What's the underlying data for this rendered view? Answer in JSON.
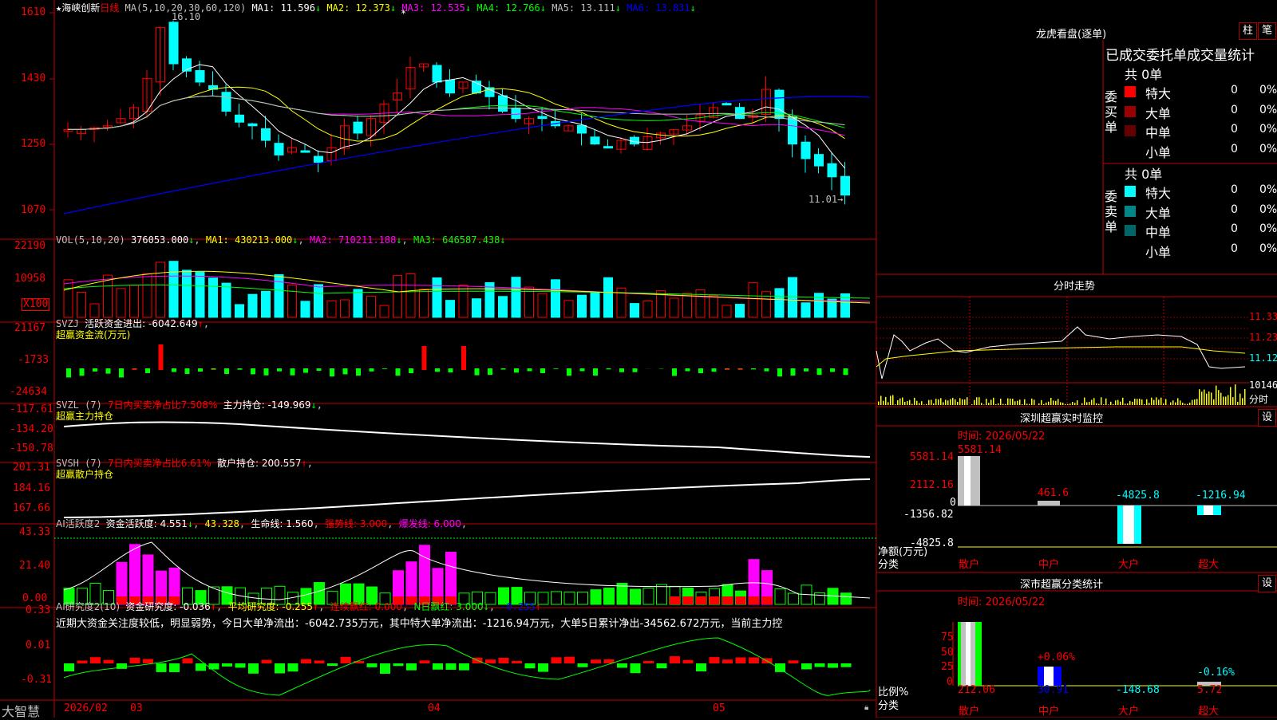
{
  "stock": {
    "name": "海峡创新",
    "period": "日线",
    "star": "★"
  },
  "main": {
    "ma_title": "MA(5,10,20,30,60,120)",
    "ma": [
      {
        "label": "MA1: 11.596",
        "arrow": "↓",
        "color": "#ffffff"
      },
      {
        "label": "MA2: 12.373",
        "arrow": "↓",
        "color": "#ffff00"
      },
      {
        "label": "MA3: 12.535",
        "arrow": "↓",
        "color": "#ff00ff"
      },
      {
        "label": "MA4: 12.766",
        "arrow": "↓",
        "color": "#00ff00"
      },
      {
        "label": "MA5: 13.111",
        "arrow": "↓",
        "color": "#c0c0c0"
      },
      {
        "label": "MA6: 13.831",
        "arrow": "↓",
        "color": "#0000ff"
      }
    ],
    "axis": [
      "1610",
      "1430",
      "1250",
      "1070"
    ],
    "high_label": "16.10",
    "low_label": "11.01"
  },
  "vol": {
    "title": "VOL(5,10,20)",
    "value": "376053.000",
    "ma1": "MA1: 430213.000",
    "ma2": "MA2: 710211.188",
    "ma3": "MA3: 646587.438",
    "axis": [
      "22190",
      "10958"
    ],
    "unit": "X100"
  },
  "svzj": {
    "title": "SVZJ",
    "desc": "活跃资金进出: -6042.649",
    "sub": "超赢资金流(万元)",
    "axis": [
      "21167",
      "-1733",
      "-24634"
    ]
  },
  "svzl": {
    "title": "SVZL (7)",
    "a": "7日内买卖净占比7.508%",
    "b": "主力持仓: -149.969",
    "sub": "超赢主力持仓",
    "axis": [
      "-117.61",
      "-134.20",
      "-150.78"
    ]
  },
  "svsh": {
    "title": "SVSH (7)",
    "a": "7日内买卖净占比6.61%",
    "b": "散户持仓: 200.557",
    "sub": "超赢散户持仓",
    "axis": [
      "201.31",
      "184.16",
      "167.66"
    ]
  },
  "ai1": {
    "title": "AI活跃度2",
    "a": "资金活跃度: 4.551",
    "b": "43.328",
    "c": "生命线: 1.560",
    "d": "强势线: 3.000",
    "e": "爆发线: 6.000",
    "axis": [
      "43.33",
      "21.40",
      "0.00"
    ]
  },
  "ai2": {
    "title": "AI研究度2(10)",
    "a": "资金研究度: -0.036",
    "b": "平均研究度: -0.255",
    "c": "连续飘红: 0.000",
    "d": "N日飘红: 3.000",
    "e": "-0.255",
    "axis": [
      "0.33",
      "0.01",
      "-0.31"
    ],
    "note": "近期大资金关注度较低，明显弱势，今日大单净流出：-6042.735万元，其中特大单净流出：-1216.94万元，大单5日累计净出-34562.672万元，当前主力控"
  },
  "dates": {
    "brand": "大智慧",
    "d1": "2026/02",
    "d2": "03",
    "d3": "04",
    "d4": "05"
  },
  "lhb": {
    "title": "龙虎看盘(逐单)",
    "btn1": "柱",
    "btn2": "笔",
    "header": "已成交委托单成交量统计",
    "buy_side": "委买单",
    "sell_side": "委卖单",
    "buy_total": "共 0单",
    "sell_total": "共 0单",
    "buy": [
      {
        "k": "特大",
        "v": "0",
        "p": "0%",
        "c": "#ff0000"
      },
      {
        "k": "大单",
        "v": "0",
        "p": "0%",
        "c": "#990000"
      },
      {
        "k": "中单",
        "v": "0",
        "p": "0%",
        "c": "#660000"
      },
      {
        "k": "小单",
        "v": "0",
        "p": "0%",
        "c": ""
      }
    ],
    "sell": [
      {
        "k": "特大",
        "v": "0",
        "p": "0%",
        "c": "#00ffff"
      },
      {
        "k": "大单",
        "v": "0",
        "p": "0%",
        "c": "#008888"
      },
      {
        "k": "中单",
        "v": "0",
        "p": "0%",
        "c": "#006666"
      },
      {
        "k": "小单",
        "v": "0",
        "p": "0%",
        "c": ""
      }
    ]
  },
  "intraday": {
    "title": "分时走势",
    "axis": [
      "11.33",
      "11.23",
      "11.12"
    ],
    "vol_label": "10146",
    "vol_tag": "分时"
  },
  "sz_monitor": {
    "title": "深圳超赢实时监控",
    "btn": "设",
    "time": "时间: 2026/05/22",
    "axis": [
      "5581.14",
      "2112.16",
      "0",
      "-1356.82",
      "-4825.8"
    ],
    "unit_a": "净额(万元)",
    "unit_b": "分类",
    "bars": [
      {
        "label": "散户",
        "value": "5581.14"
      },
      {
        "label": "中户",
        "value": "461.6"
      },
      {
        "label": "大户",
        "value": "-4825.8"
      },
      {
        "label": "超大",
        "value": "-1216.94"
      }
    ]
  },
  "sz_stat": {
    "title": "深市超赢分类统计",
    "btn": "设",
    "time": "时间: 2026/05/22",
    "axis": [
      "75",
      "50",
      "25",
      "0"
    ],
    "unit_a": "比例%",
    "unit_b": "分类",
    "pct": [
      "+0.06%",
      "-0.16%"
    ],
    "bars": [
      {
        "label": "散户",
        "value": "212.06"
      },
      {
        "label": "中户",
        "value": "30.91"
      },
      {
        "label": "大户",
        "value": "-148.68"
      },
      {
        "label": "超大",
        "value": "5.72"
      }
    ]
  }
}
